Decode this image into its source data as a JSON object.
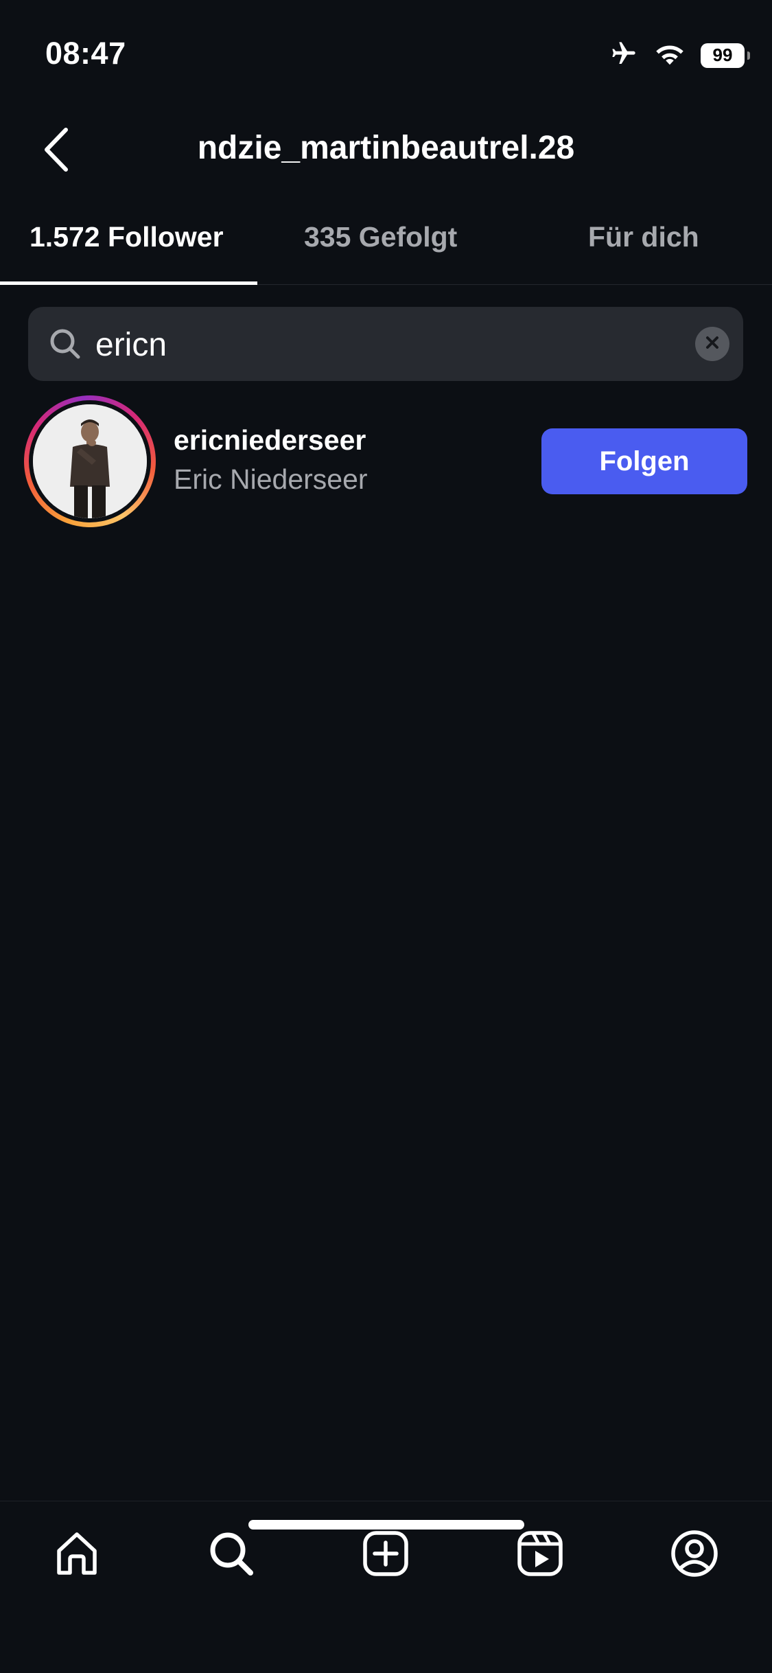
{
  "status_bar": {
    "time": "08:47",
    "battery_level": "99",
    "icons": [
      "airplane-icon",
      "wifi-icon",
      "battery-icon"
    ]
  },
  "header": {
    "title": "ndzie_martinbeautrel.28",
    "back_icon": "chevron-left-icon"
  },
  "tabs": [
    {
      "label": "1.572 Follower",
      "active": true
    },
    {
      "label": "335 Gefolgt",
      "active": false
    },
    {
      "label": "Für dich",
      "active": false
    }
  ],
  "search": {
    "value": "ericn",
    "icon": "search-icon",
    "clear_icon": "clear-icon"
  },
  "results": [
    {
      "username": "ericniederseer",
      "full_name": "Eric Niederseer",
      "has_story_ring": true,
      "button_label": "Folgen"
    }
  ],
  "bottom_nav": {
    "items": [
      "home-icon",
      "search-icon",
      "create-icon",
      "reels-icon",
      "profile-icon"
    ]
  },
  "colors": {
    "background": "#0c0f14",
    "search_bg": "#272a30",
    "primary_button": "#4a5cf0",
    "secondary_text": "#a7a9ae"
  }
}
